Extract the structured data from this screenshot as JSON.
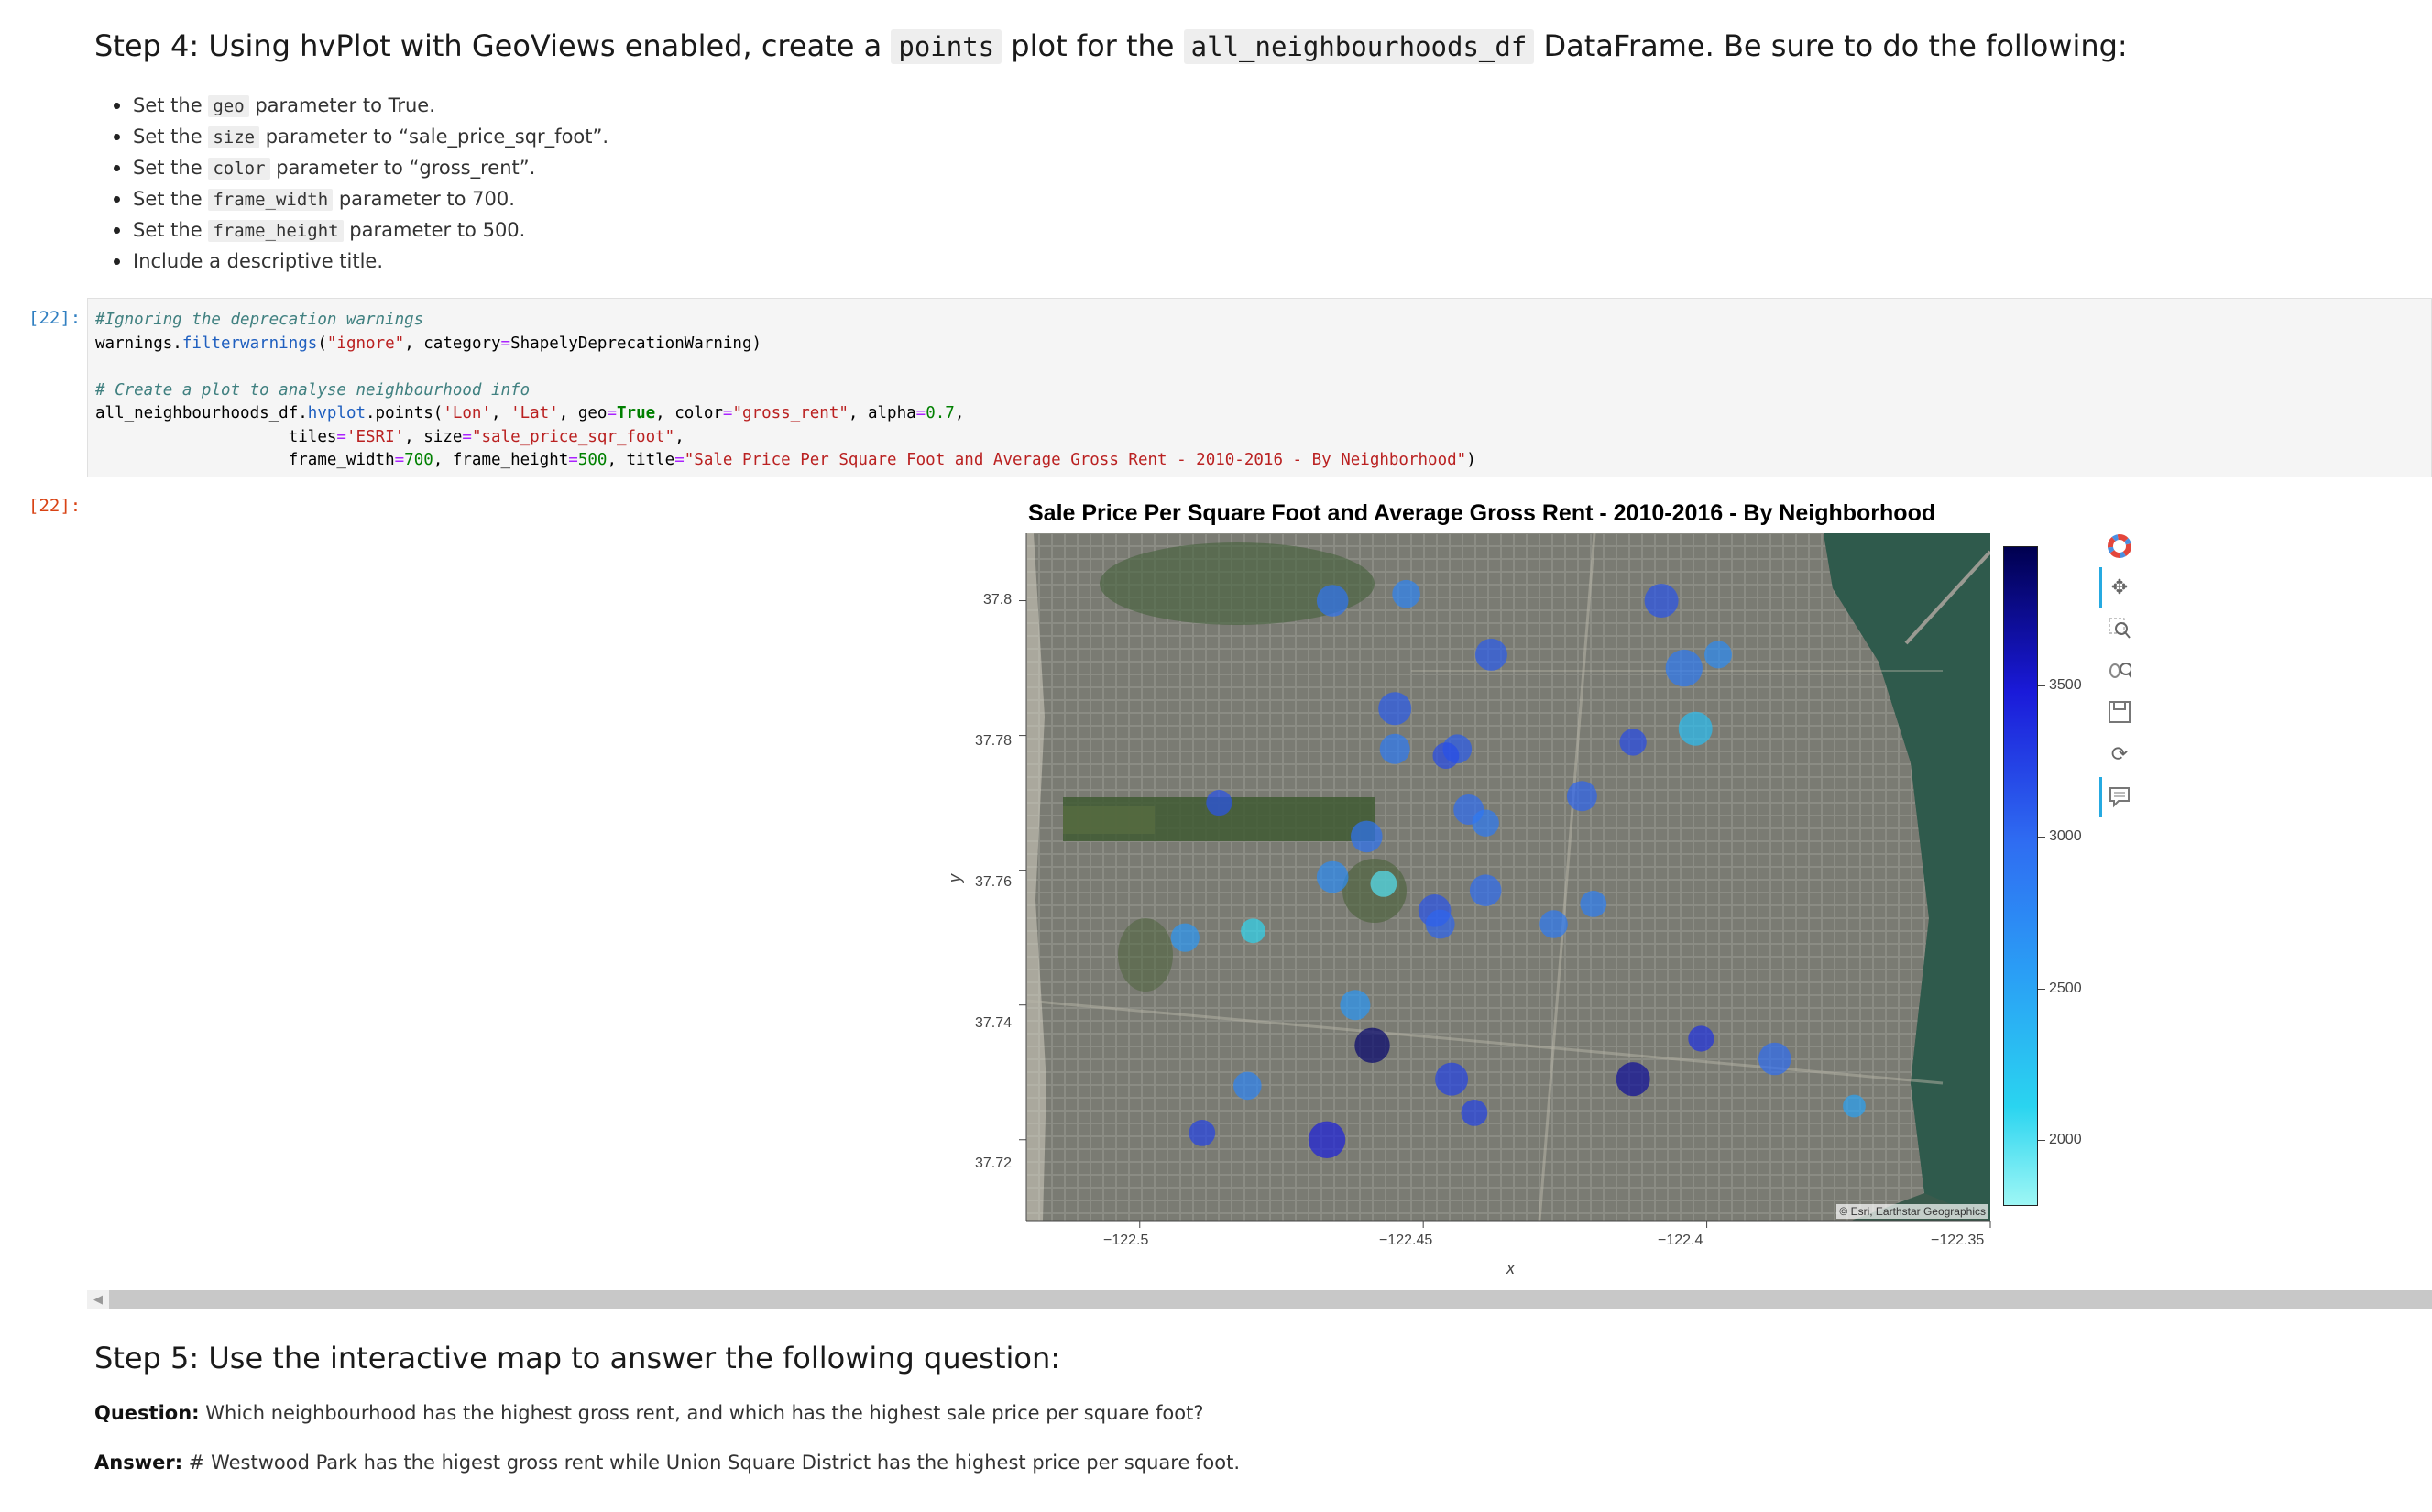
{
  "step4": {
    "prefix": "Step 4: Using hvPlot with GeoViews enabled, create a",
    "code1": "points",
    "mid": "plot for the",
    "code2": "all_neighbourhoods_df",
    "suffix": "DataFrame. Be sure to do the following:"
  },
  "bullets": [
    {
      "pre": "Set the",
      "code": "geo",
      "post": "parameter to True."
    },
    {
      "pre": "Set the",
      "code": "size",
      "post": "parameter to “sale_price_sqr_foot”."
    },
    {
      "pre": "Set the",
      "code": "color",
      "post": "parameter to “gross_rent”."
    },
    {
      "pre": "Set the",
      "code": "frame_width",
      "post": "parameter to 700."
    },
    {
      "pre": "Set the",
      "code": "frame_height",
      "post": "parameter to 500."
    },
    {
      "text": "Include a descriptive title."
    }
  ],
  "cell": {
    "in_prompt": "[22]:",
    "out_prompt": "[22]:",
    "line1": "#Ignoring the deprecation warnings",
    "line2": {
      "a": "warnings.",
      "b": "filterwarnings",
      "c": "(",
      "d": "\"ignore\"",
      "e": ", category",
      "f": "=",
      "g": "ShapelyDeprecationWarning)"
    },
    "line4": "# Create a plot to analyse neighbourhood info",
    "line5": {
      "a": "all_neighbourhoods_df.",
      "b": "hvplot",
      "c": ".points(",
      "d": "'Lon'",
      "e": ", ",
      "f": "'Lat'",
      "g": ", geo",
      "h": "=",
      "i": "True",
      "j": ", color",
      "k": "=",
      "l": "\"gross_rent\"",
      "m": ", alpha",
      "n": "=",
      "o": "0.7",
      "p": ","
    },
    "line6": {
      "a": "tiles",
      "b": "=",
      "c": "'ESRI'",
      "d": ", size",
      "e": "=",
      "f": "\"sale_price_sqr_foot\"",
      "g": ","
    },
    "line7": {
      "a": "frame_width",
      "b": "=",
      "c": "700",
      "d": ", frame_height",
      "e": "=",
      "f": "500",
      "g": ", title",
      "h": "=",
      "i": "\"Sale Price Per Square Foot and Average Gross Rent - 2010-2016 - By Neighborhood\"",
      "j": ")"
    }
  },
  "plot": {
    "title": "Sale Price Per Square Foot and Average Gross Rent - 2010-2016 - By Neighborhood",
    "xlabel": "x",
    "ylabel": "y",
    "attribution": "© Esri, Earthstar Geographics",
    "x_ticks": [
      "−122.5",
      "−122.45",
      "−122.4",
      "−122.35"
    ],
    "y_ticks": [
      "37.8",
      "37.78",
      "37.76",
      "37.74",
      "37.72"
    ],
    "colorbar_ticks": [
      "3500",
      "3000",
      "2500",
      "2000"
    ],
    "toolbar": [
      "bokeh-logo-icon",
      "pan-icon",
      "box-zoom-icon",
      "wheel-zoom-icon",
      "save-icon",
      "reset-icon",
      "hover-icon"
    ]
  },
  "chart_data": {
    "type": "scatter",
    "title": "Sale Price Per Square Foot and Average Gross Rent - 2010-2016 - By Neighborhood",
    "xlabel": "x",
    "ylabel": "y",
    "xlim": [
      -122.52,
      -122.35
    ],
    "ylim": [
      37.708,
      37.81
    ],
    "color_field": "gross_rent",
    "color_range": [
      1800,
      3900
    ],
    "points": [
      {
        "x": -122.466,
        "y": 37.8,
        "size": 330,
        "c": 2900
      },
      {
        "x": -122.453,
        "y": 37.801,
        "size": 260,
        "c": 2750
      },
      {
        "x": -122.408,
        "y": 37.8,
        "size": 380,
        "c": 3100
      },
      {
        "x": -122.438,
        "y": 37.792,
        "size": 340,
        "c": 3050
      },
      {
        "x": -122.404,
        "y": 37.79,
        "size": 450,
        "c": 2850
      },
      {
        "x": -122.398,
        "y": 37.792,
        "size": 250,
        "c": 2700
      },
      {
        "x": -122.455,
        "y": 37.784,
        "size": 360,
        "c": 3050
      },
      {
        "x": -122.402,
        "y": 37.781,
        "size": 380,
        "c": 2300
      },
      {
        "x": -122.455,
        "y": 37.778,
        "size": 300,
        "c": 2850
      },
      {
        "x": -122.444,
        "y": 37.778,
        "size": 280,
        "c": 3050
      },
      {
        "x": -122.446,
        "y": 37.777,
        "size": 230,
        "c": 3150
      },
      {
        "x": -122.413,
        "y": 37.779,
        "size": 240,
        "c": 3150
      },
      {
        "x": -122.486,
        "y": 37.77,
        "size": 220,
        "c": 3100
      },
      {
        "x": -122.422,
        "y": 37.771,
        "size": 300,
        "c": 3000
      },
      {
        "x": -122.442,
        "y": 37.769,
        "size": 300,
        "c": 2950
      },
      {
        "x": -122.439,
        "y": 37.767,
        "size": 240,
        "c": 2850
      },
      {
        "x": -122.46,
        "y": 37.765,
        "size": 330,
        "c": 2900
      },
      {
        "x": -122.466,
        "y": 37.759,
        "size": 330,
        "c": 2700
      },
      {
        "x": -122.457,
        "y": 37.758,
        "size": 230,
        "c": 2000
      },
      {
        "x": -122.439,
        "y": 37.757,
        "size": 330,
        "c": 2950
      },
      {
        "x": -122.448,
        "y": 37.754,
        "size": 350,
        "c": 3100
      },
      {
        "x": -122.447,
        "y": 37.752,
        "size": 280,
        "c": 3000
      },
      {
        "x": -122.42,
        "y": 37.755,
        "size": 230,
        "c": 2800
      },
      {
        "x": -122.427,
        "y": 37.752,
        "size": 260,
        "c": 2850
      },
      {
        "x": -122.492,
        "y": 37.75,
        "size": 270,
        "c": 2600
      },
      {
        "x": -122.48,
        "y": 37.751,
        "size": 200,
        "c": 2100
      },
      {
        "x": -122.462,
        "y": 37.74,
        "size": 300,
        "c": 2600
      },
      {
        "x": -122.459,
        "y": 37.734,
        "size": 410,
        "c": 3800
      },
      {
        "x": -122.401,
        "y": 37.735,
        "size": 220,
        "c": 3300
      },
      {
        "x": -122.388,
        "y": 37.732,
        "size": 350,
        "c": 2950
      },
      {
        "x": -122.445,
        "y": 37.729,
        "size": 360,
        "c": 3200
      },
      {
        "x": -122.413,
        "y": 37.729,
        "size": 380,
        "c": 3650
      },
      {
        "x": -122.481,
        "y": 37.728,
        "size": 260,
        "c": 2750
      },
      {
        "x": -122.374,
        "y": 37.725,
        "size": 170,
        "c": 2500
      },
      {
        "x": -122.441,
        "y": 37.724,
        "size": 230,
        "c": 3200
      },
      {
        "x": -122.489,
        "y": 37.721,
        "size": 230,
        "c": 3200
      },
      {
        "x": -122.467,
        "y": 37.72,
        "size": 450,
        "c": 3400
      }
    ]
  },
  "step5": {
    "heading": "Step 5: Use the interactive map to answer the following question:",
    "q_label": "Question:",
    "q_text": "Which neighbourhood has the highest gross rent, and which has the highest sale price per square foot?",
    "a_label": "Answer:",
    "a_text": "# Westwood Park has the higest gross rent while Union Square District has the highest price per square foot."
  }
}
